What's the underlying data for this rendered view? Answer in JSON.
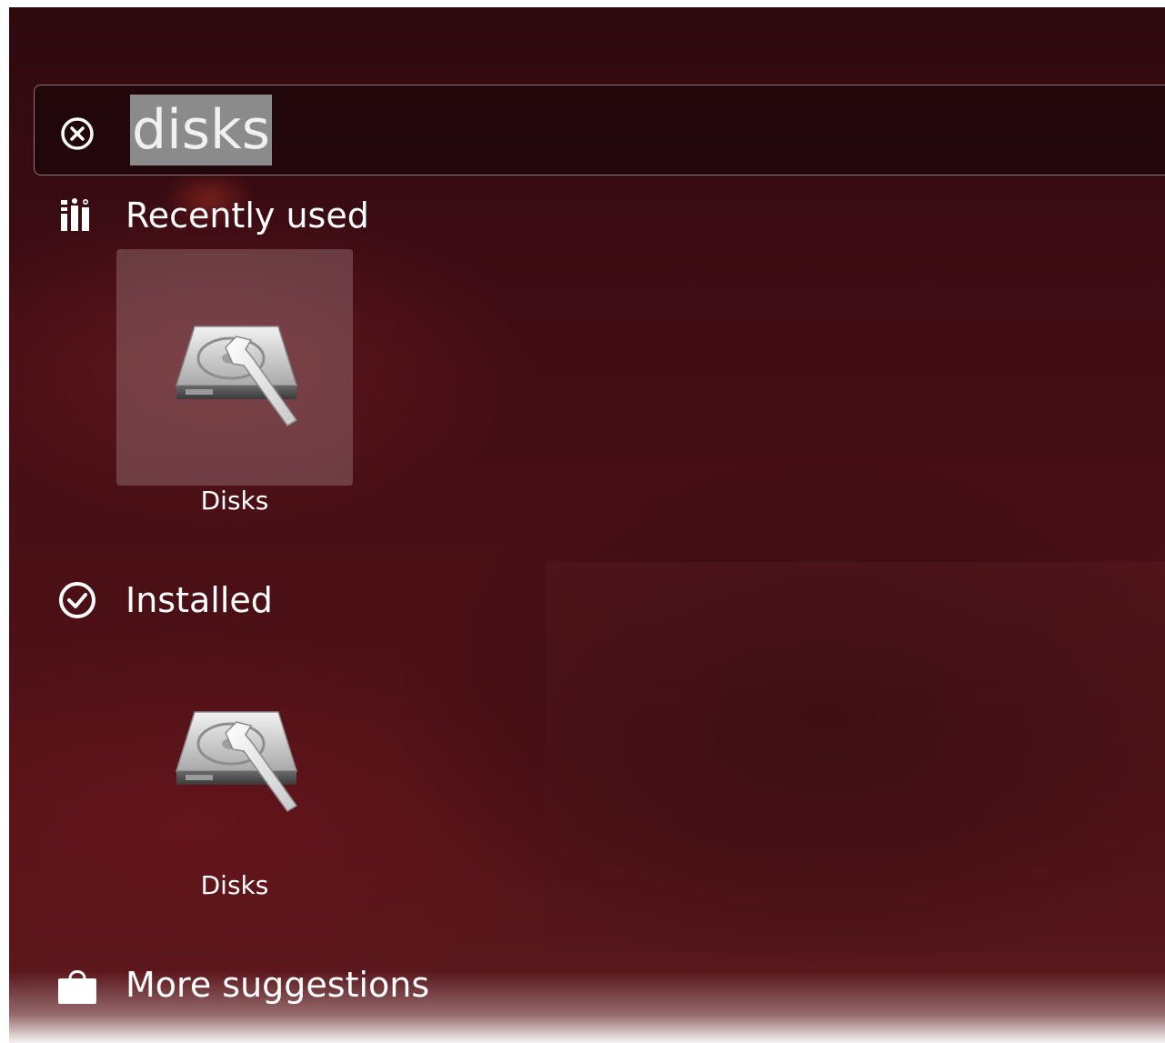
{
  "search": {
    "query": "disks"
  },
  "categories": [
    {
      "label": "Recently used",
      "icon": "recently-used-icon",
      "items": [
        {
          "label": "Disks",
          "icon": "disks-app-icon",
          "highlighted": true
        }
      ]
    },
    {
      "label": "Installed",
      "icon": "installed-check-icon",
      "items": [
        {
          "label": "Disks",
          "icon": "disks-app-icon",
          "highlighted": false
        }
      ]
    },
    {
      "label": "More suggestions",
      "icon": "shopping-bag-icon",
      "items": []
    }
  ],
  "colors": {
    "background_dark": "#2e0a0f",
    "background_mid": "#4a1016",
    "text": "#ffffff",
    "selection": "#8b8b8b"
  }
}
